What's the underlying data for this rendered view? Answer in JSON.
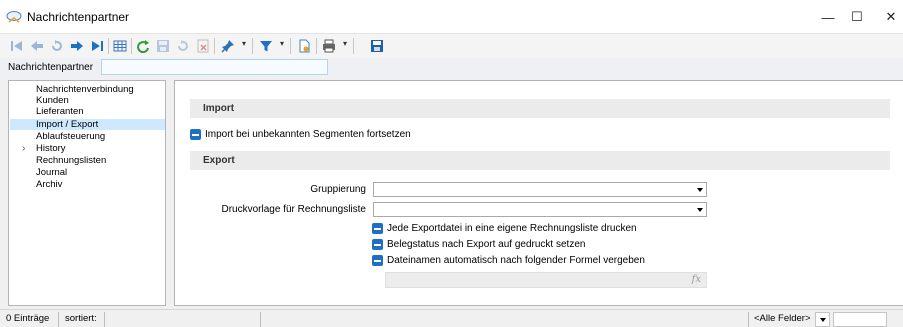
{
  "window": {
    "title": "Nachrichtenpartner",
    "minimize_glyph": "—",
    "maximize_glyph": "☐",
    "close_glyph": "✕"
  },
  "toolbar": {
    "buttons": [
      "first-record-icon",
      "previous-record-icon",
      "undo-icon",
      "next-record-icon",
      "last-record-icon",
      "table-view-icon",
      "refresh-icon",
      "save-icon",
      "revert-icon",
      "delete-icon",
      "pin-icon",
      "filter-icon",
      "document-icon",
      "print-icon",
      "save-disk-icon"
    ],
    "dropdown_glyph": "▾"
  },
  "filter": {
    "label": "Nachrichtenpartner",
    "value": ""
  },
  "nav": {
    "items": [
      {
        "label": "Nachrichtenverbindung",
        "selected": false,
        "expandable": false
      },
      {
        "label": "Kunden",
        "selected": false,
        "expandable": false
      },
      {
        "label": "Lieferanten",
        "selected": false,
        "expandable": false
      },
      {
        "label": "Import / Export",
        "selected": true,
        "expandable": false
      },
      {
        "label": "Ablaufsteuerung",
        "selected": false,
        "expandable": false
      },
      {
        "label": "History",
        "selected": false,
        "expandable": true
      },
      {
        "label": "Rechnungslisten",
        "selected": false,
        "expandable": false
      },
      {
        "label": "Journal",
        "selected": false,
        "expandable": false
      },
      {
        "label": "Archiv",
        "selected": false,
        "expandable": false
      }
    ],
    "expand_glyph": "›"
  },
  "main": {
    "import_header": "Import",
    "import_checkbox": "Import bei unbekannten Segmenten fortsetzen",
    "export_header": "Export",
    "gruppierung_label": "Gruppierung",
    "gruppierung_value": "",
    "druckvorlage_label": "Druckvorlage für Rechnungsliste",
    "druckvorlage_value": "",
    "export_checkboxes": [
      "Jede Exportdatei in eine eigene Rechnungsliste drucken",
      "Belegstatus nach Export auf gedruckt setzen",
      "Dateinamen automatisch nach folgender Formel vergeben"
    ],
    "formula_value": "",
    "fx_label": "fx"
  },
  "status": {
    "count": "0 Einträge",
    "sorted": "sortiert:",
    "field_selector": "<Alle Felder>",
    "search_value": ""
  },
  "colors": {
    "accent": "#1e6fc6",
    "selection": "#cde8ff",
    "section_header": "#ebebeb"
  }
}
